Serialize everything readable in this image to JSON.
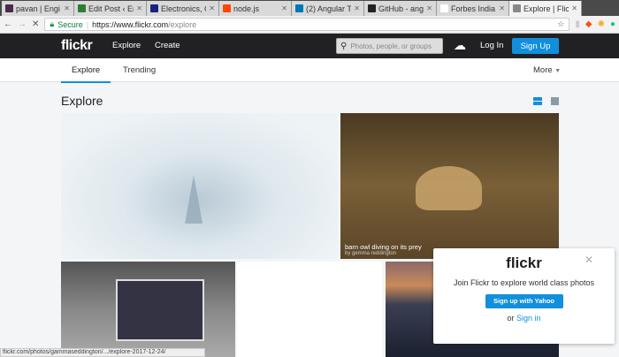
{
  "browser": {
    "tabs": [
      {
        "title": "pavan | Engi",
        "color": "#4a2a4a",
        "active": false
      },
      {
        "title": "Edit Post ‹ En",
        "color": "#2e7d32",
        "active": false
      },
      {
        "title": "Electronics, C",
        "color": "#1a237e",
        "active": false
      },
      {
        "title": "node.js",
        "color": "#ff4500",
        "active": false
      },
      {
        "title": "(2) Angular T",
        "color": "#0077b5",
        "active": false
      },
      {
        "title": "GitHub - angu",
        "color": "#222222",
        "active": false
      },
      {
        "title": "Forbes India",
        "color": "#ffffff",
        "active": false
      },
      {
        "title": "Explore | Flic",
        "color": "#888888",
        "active": true
      }
    ],
    "secure_label": "Secure",
    "url_host": "https://www.flickr.com",
    "url_path": "/explore"
  },
  "nav": {
    "logo": "flickr",
    "explore": "Explore",
    "create": "Create",
    "search_placeholder": "Photos, people, or groups",
    "login": "Log In",
    "signup": "Sign Up"
  },
  "subnav": {
    "tabs": [
      "Explore",
      "Trending"
    ],
    "more": "More"
  },
  "page": {
    "title": "Explore"
  },
  "photos": [
    {
      "caption": "barn owl diving on its prey",
      "author": "by gemma reddington"
    }
  ],
  "popup": {
    "logo": "flickr",
    "text_pre": "Join ",
    "text_brand": "Flickr",
    "text_post": " to explore world class photos",
    "button": "Sign up with Yahoo",
    "or": "or ",
    "signin": "Sign in"
  },
  "status_bar": "flickr.com/photos/gammaseddington/.../explore-2017-12-24/",
  "colors": {
    "accent": "#128fdc",
    "nav_bg": "#212124"
  }
}
